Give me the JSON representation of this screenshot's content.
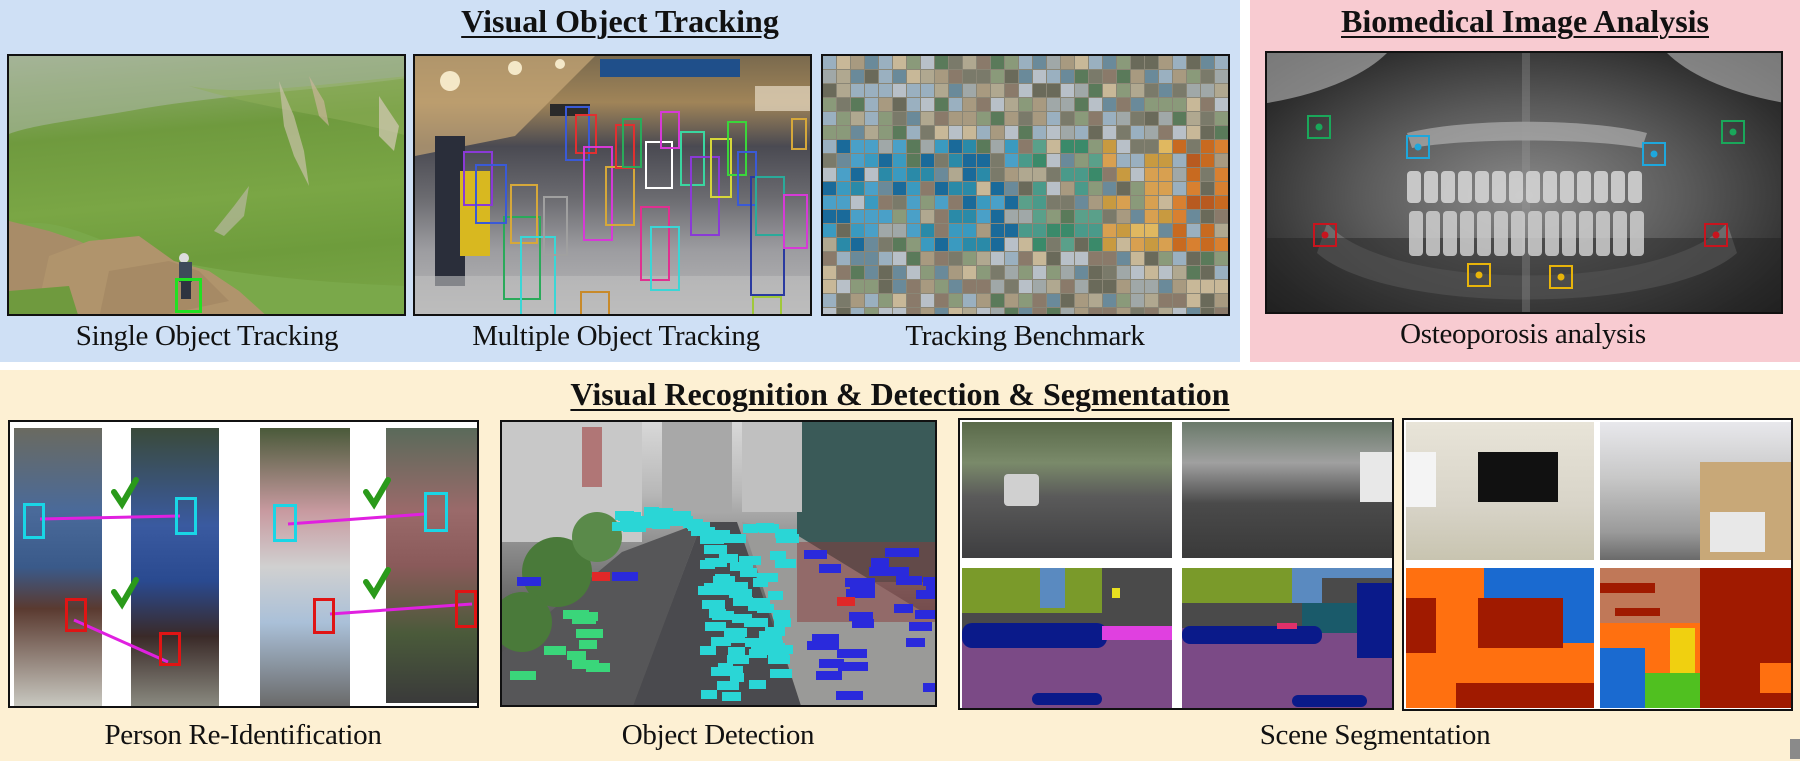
{
  "sections": {
    "tracking": {
      "title": "Visual Object Tracking",
      "background": "#cfe0f5",
      "panels": [
        {
          "caption": "Single Object Tracking",
          "image": "hillside-cyclist-with-green-tracking-box"
        },
        {
          "caption": "Multiple Object Tracking",
          "image": "crowded-concourse-with-multicolor-boxes"
        },
        {
          "caption": "Tracking Benchmark",
          "image": "mosaic-of-thumbnails-spelling-lasot"
        }
      ]
    },
    "biomedical": {
      "title": "Biomedical Image Analysis",
      "background": "#f8cbd1",
      "panels": [
        {
          "caption": "Osteoporosis analysis",
          "image": "dental-panoramic-xray-with-roi-markers"
        }
      ],
      "roi_colors": [
        "#1aa75a",
        "#1ea7dc",
        "#c8141e",
        "#e8b40a"
      ]
    },
    "recognition": {
      "title": "Visual Recognition & Detection & Segmentation",
      "background": "#fdf0d3",
      "panels": [
        {
          "caption": "Person Re-Identification",
          "image": "pedestrian-pairs-with-matched-parts"
        },
        {
          "caption": "Object Detection",
          "image": "city-street-aerial-with-detections"
        },
        {
          "caption": "Scene Segmentation",
          "image": "outdoor-and-indoor-scenes-with-segmentation-maps"
        }
      ]
    }
  },
  "colors": {
    "sot_box": "#22e022",
    "reid_match_line": "#e020e0",
    "reid_upper": "#19d6e6",
    "reid_lower": "#e01414",
    "check": "#2a9a1a",
    "det_car": "#2ad6d6",
    "det_ped": "#2a2adc",
    "det_tree": "#3ad67a",
    "det_red": "#e02828"
  }
}
